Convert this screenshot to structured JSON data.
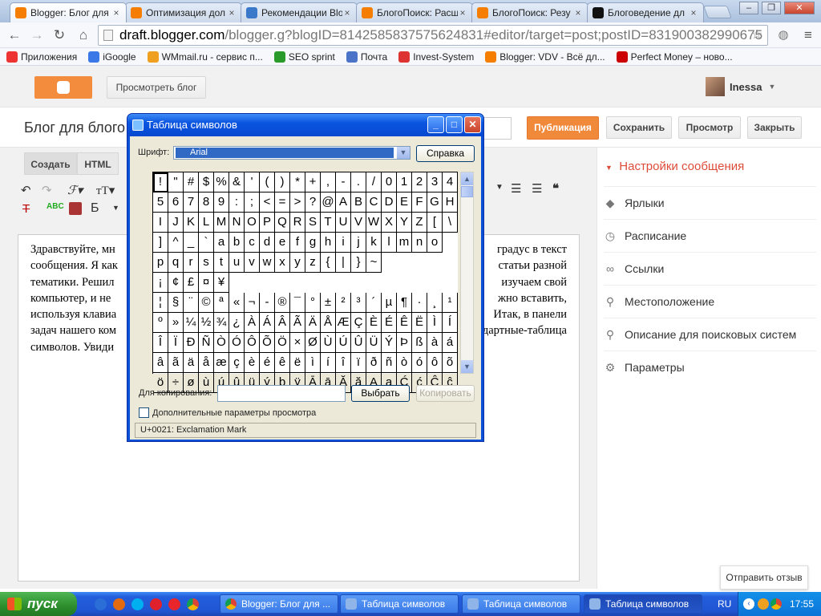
{
  "browser": {
    "tabs": [
      {
        "title": "Blogger: Блог для",
        "icon_color": "#f57d00",
        "active": true
      },
      {
        "title": "Оптимизация дол",
        "icon_color": "#f57d00",
        "active": false
      },
      {
        "title": "Рекомендации Blo",
        "icon_color": "#3a78c9",
        "active": false
      },
      {
        "title": "БлогоПоиск: Расш",
        "icon_color": "#f57d00",
        "active": false
      },
      {
        "title": "БлогоПоиск: Резу",
        "icon_color": "#f57d00",
        "active": false
      },
      {
        "title": "Блоговедение дл",
        "icon_color": "#111111",
        "active": false
      }
    ],
    "url_host": "draft.blogger.com",
    "url_rest": "/blogger.g?blogID=8142585837575624831#editor/target=post;postID=831900382990675",
    "bookmarks": [
      {
        "label": "Приложения",
        "icon_color": "#e33"
      },
      {
        "label": "iGoogle",
        "icon_color": "#3b78e7"
      },
      {
        "label": "WMmail.ru - сервис п...",
        "icon_color": "#f0a020"
      },
      {
        "label": "SEO sprint",
        "icon_color": "#2a9a2a"
      },
      {
        "label": "Почта",
        "icon_color": "#4b74c9"
      },
      {
        "label": "Invest-System",
        "icon_color": "#d33"
      },
      {
        "label": "Blogger: VDV - Всё дл...",
        "icon_color": "#f57d00"
      },
      {
        "label": "Perfect Money – ново...",
        "icon_color": "#c00"
      }
    ]
  },
  "blogger": {
    "view_blog": "Просмотреть блог",
    "user": "Inessa",
    "post_title": "Блог для блого",
    "actions": {
      "publish": "Публикация",
      "save": "Сохранить",
      "preview": "Просмотр",
      "close": "Закрыть"
    },
    "mode_tabs": {
      "compose": "Создать",
      "html": "HTML"
    },
    "toolbar": {
      "bold": "Б"
    },
    "doc_lines": [
      "Здравствуйте, мн",
      "сообщения. Я как",
      "тематики. Решил",
      "компьютер, и не",
      "используя клавиа",
      "задач нашего ком",
      "символов. Увиди"
    ],
    "doc_lines_right": [
      "градус в текст",
      "статьи разной",
      "изучаем свой",
      "жно вставить,",
      "Итак, в панели",
      "дартные-таблица",
      ""
    ],
    "sidebar": {
      "heading": "Настройки сообщения",
      "items": [
        {
          "label": "Ярлыки",
          "icon": "tag-icon"
        },
        {
          "label": "Расписание",
          "icon": "clock-icon"
        },
        {
          "label": "Ссылки",
          "icon": "link-icon"
        },
        {
          "label": "Местоположение",
          "icon": "location-pin-icon"
        },
        {
          "label": "Описание для поисковых систем",
          "icon": "search-icon"
        },
        {
          "label": "Параметры",
          "icon": "gear-icon"
        }
      ]
    },
    "feedback": "Отправить отзыв",
    "accent_color": "#f1893b"
  },
  "charmap": {
    "title": "Таблица символов",
    "font_label": "Шрифт:",
    "font_value": "Arial",
    "help_button": "Справка",
    "chars": "!\"#$%&'()*+,-./01234 56789:;<=>?@ABCDEFGH IJKLMNOPQRSTUVWXYZ[\\ ]^_`abcdefghijklmno pqrstuvwxyz{|}~ ¡¢£¤¥ ¦§¨©ª«¬-®¯°±²³´µ¶·¸¹ º»¼½¾¿ÀÁÂÃÄÅÆÇÈÉÊËÌÍ ÎÏÐÑÒÓÔÕÖ×ØÙÚÛÜÝÞßàá âãäåæçèéêëìíîïðñòóôõ ö÷øùúûüýþÿĀāĂăĄąĆćĈĉ",
    "copy_label": "Для копирования:",
    "copy_value": "",
    "select_button": "Выбрать",
    "copy_button": "Копировать",
    "advanced_label": "Дополнительные параметры просмотра",
    "status": "U+0021: Exclamation Mark"
  },
  "taskbar": {
    "start": "пуск",
    "items": [
      {
        "label": "Blogger: Блог для ...",
        "active": false
      },
      {
        "label": "Таблица символов",
        "active": false
      },
      {
        "label": "Таблица символов",
        "active": false
      },
      {
        "label": "Таблица символов",
        "active": true
      }
    ],
    "lang": "RU",
    "clock": "17:55"
  }
}
